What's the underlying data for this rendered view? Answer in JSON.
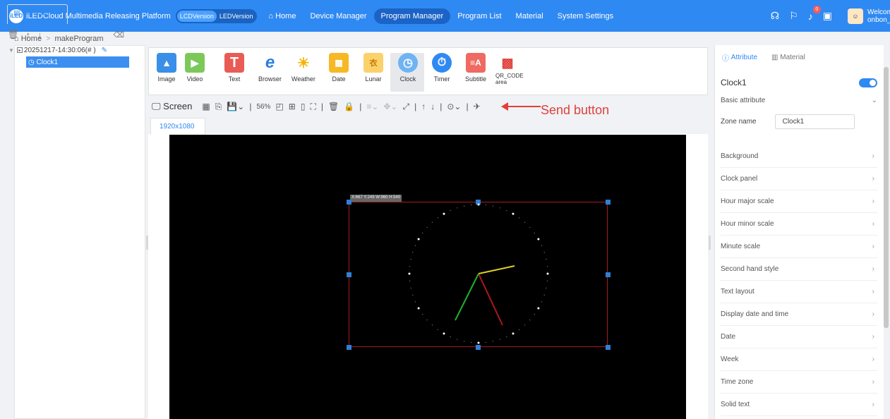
{
  "header": {
    "logo_text": "iLED",
    "title": "iLEDCloud Multimedia Releasing Platform",
    "versions": [
      "LCDVersion",
      "LEDVersion"
    ],
    "nav": [
      "Home",
      "Device Manager",
      "Program Manager",
      "Program List",
      "Material",
      "System Settings"
    ],
    "notification_count": "0",
    "welcome_line1": "Welcome",
    "welcome_line2": "onbon_z"
  },
  "breadcrumb": {
    "home": "Home",
    "current": "makeProgram"
  },
  "left_panel": {
    "tab_label": "Content",
    "program_name": "20251217-14:30:06(# )",
    "selected_item": "Clock1"
  },
  "tools": [
    {
      "label": "Image",
      "icon": "image-icon"
    },
    {
      "label": "Video",
      "icon": "video-icon"
    },
    {
      "label": "Text",
      "icon": "text-icon"
    },
    {
      "label": "Browser",
      "icon": "browser-icon"
    },
    {
      "label": "Weather",
      "icon": "weather-icon"
    },
    {
      "label": "Date",
      "icon": "date-icon"
    },
    {
      "label": "Lunar",
      "icon": "lunar-icon"
    },
    {
      "label": "Clock",
      "icon": "clock-icon"
    },
    {
      "label": "Timer",
      "icon": "timer-icon"
    },
    {
      "label": "Subtitle",
      "icon": "subtitle-icon"
    },
    {
      "label": "QR_CODE area",
      "icon": "qr-code-icon"
    }
  ],
  "toolbar": {
    "screen_label": "Screen",
    "zoom": "56%",
    "send_annotation": "Send button"
  },
  "canvas": {
    "resolution_tab": "1920x1080",
    "zone_info": "X:667 Y:249 W:960 H:540"
  },
  "colors": {
    "accent": "#2f89f2",
    "annotation": "#e0403a",
    "hour_hand": "#b01818",
    "minute_hand": "#e0d020",
    "second_hand": "#1fae2e"
  },
  "right_panel": {
    "tabs": [
      "Attribute",
      "Material"
    ],
    "zone_title": "Clock1",
    "basic_attribute": "Basic attribute",
    "zone_name_label": "Zone name",
    "zone_name_value": "Clock1",
    "sections": [
      "Background",
      "Clock panel",
      "Hour major scale",
      "Hour minor scale",
      "Minute scale",
      "Second hand style",
      "Text layout",
      "Display date and time",
      "Date",
      "Week",
      "Time zone",
      "Solid text"
    ]
  }
}
